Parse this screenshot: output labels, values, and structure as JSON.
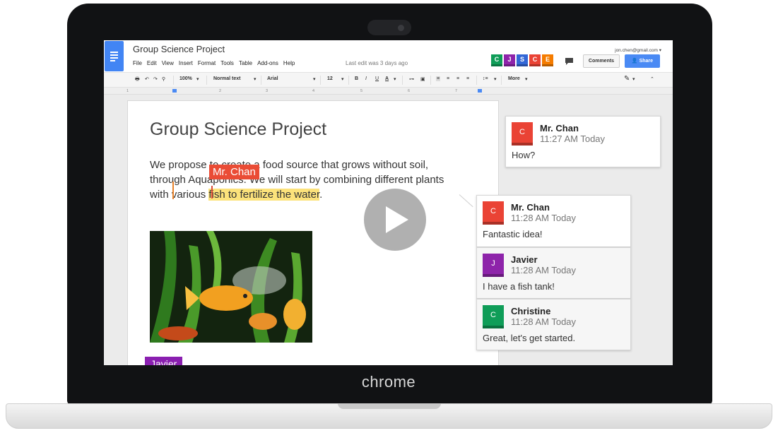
{
  "device": {
    "brand": "chrome"
  },
  "doc": {
    "title": "Group Science Project",
    "menu": [
      "File",
      "Edit",
      "View",
      "Insert",
      "Format",
      "Tools",
      "Table",
      "Add-ons",
      "Help"
    ],
    "last_edit": "Last edit was 3 days ago",
    "account_email": "jon.chen@gmail.com ▾",
    "collaborators": [
      {
        "initial": "C",
        "color": "#0f9d58"
      },
      {
        "initial": "J",
        "color": "#8e24aa"
      },
      {
        "initial": "S",
        "color": "#3367d6"
      },
      {
        "initial": "C",
        "color": "#ea4335"
      },
      {
        "initial": "E",
        "color": "#f57c00"
      }
    ],
    "comments_button": "Comments",
    "share_button": "Share"
  },
  "toolbar": {
    "zoom": "100%",
    "style": "Normal text",
    "font": "Arial",
    "size": "12",
    "more": "More"
  },
  "ruler_ticks": [
    "1",
    "2",
    "3",
    "4",
    "5",
    "6",
    "7"
  ],
  "page": {
    "heading": "Group Science Project",
    "line1": "We propose to create a food source that grows without soil,",
    "line2": "through Aquaponics. We will start by combining different plants",
    "line3_a": "with various ",
    "line3_b": "fish to fertilize the water",
    "line3_c": ".",
    "cursor_tag": "Mr. Chan",
    "javier_tag": "Javier"
  },
  "comments": [
    {
      "initial": "C",
      "color": "#ea4335",
      "name": "Mr. Chan",
      "time": "11:27 AM Today",
      "text": "How?"
    },
    {
      "initial": "C",
      "color": "#ea4335",
      "name": "Mr. Chan",
      "time": "11:28 AM Today",
      "text": "Fantastic idea!"
    },
    {
      "initial": "J",
      "color": "#8e24aa",
      "name": "Javier",
      "time": "11:28 AM Today",
      "text": "I have a fish tank!"
    },
    {
      "initial": "C",
      "color": "#0f9d58",
      "name": "Christine",
      "time": "11:28 AM Today",
      "text": "Great, let's get started."
    }
  ]
}
